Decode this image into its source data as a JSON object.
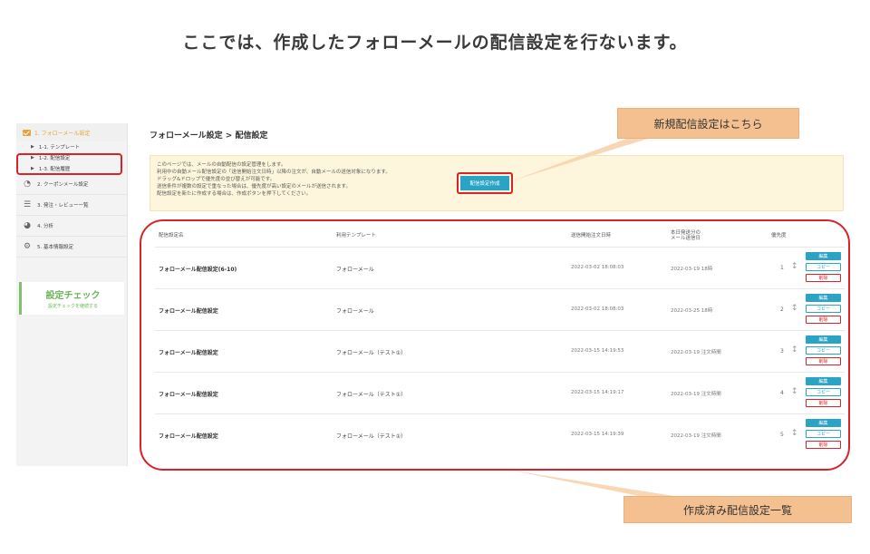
{
  "slide": {
    "title": "ここでは、作成したフォローメールの配信設定を行ないます。"
  },
  "sidebar": {
    "top_item": "1. フォローメール設定",
    "sub_items": [
      "1-1. テンプレート",
      "1-2. 配信設定",
      "1-3. 配信履歴"
    ],
    "items": [
      {
        "label": "2. クーポンメール設定",
        "icon": "coupon-icon"
      },
      {
        "label": "3. 発注・レビュー一覧",
        "icon": "list-icon"
      },
      {
        "label": "4. 分析",
        "icon": "pie-chart-icon"
      },
      {
        "label": "5. 基本情報設定",
        "icon": "gear-icon"
      }
    ],
    "check": {
      "title": "設定チェック",
      "subtitle": "設定チェックを継続する"
    }
  },
  "main": {
    "title": "フォローメール設定 > 配信設定",
    "notice_lines": [
      "このページでは、メールの自動配信の設定管理をします。",
      "利用中の自動メール配信設定の「送信開始注文日時」以降の注文が、自動メールの送信対象になります。",
      "ドラッグ&ドロップで優先度の並び替えが可能です。",
      "送信条件が複数の設定で重なった場合は、優先度が高い設定のメールが送信されます。",
      "配信設定を新たに作成する場合は、作成ボタンを押下してください。"
    ],
    "create_button": "配信設定作成",
    "table": {
      "headers": [
        "配信設定名",
        "利用テンプレート",
        "送信開始注文日時",
        "本日発送分の\nメール送信日",
        "優先度"
      ],
      "actions": {
        "edit": "編集",
        "copy": "コピー",
        "delete": "削除"
      },
      "rows": [
        {
          "name": "フォローメール配信設定(6-10)",
          "template": "フォローメール",
          "start": "2022-03-02 18:08:03",
          "send": "2022-03-19 18時",
          "priority": "1"
        },
        {
          "name": "フォローメール配信設定",
          "template": "フォローメール",
          "start": "2022-03-02 18:08:03",
          "send": "2022-03-25 18時",
          "priority": "2"
        },
        {
          "name": "フォローメール配信設定",
          "template": "フォローメール（テスト①）",
          "start": "2022-03-15 14:19:53",
          "send": "2022-03-19 注文時間",
          "priority": "3"
        },
        {
          "name": "フォローメール配信設定",
          "template": "フォローメール（テスト①）",
          "start": "2022-03-15 14:19:17",
          "send": "2022-03-19 注文時間",
          "priority": "4"
        },
        {
          "name": "フォローメール配信設定",
          "template": "フォローメール（テスト①）",
          "start": "2022-03-15 14:19:39",
          "send": "2022-03-19 注文時間",
          "priority": "5"
        }
      ]
    }
  },
  "callouts": {
    "new_setting": "新規配信設定はこちら",
    "created_list": "作成済み配信設定一覧"
  },
  "colors": {
    "accent": "#2aa3c5",
    "highlight_ring": "#d8232a",
    "callout": "#f5c08f",
    "check_green": "#6ab557"
  }
}
